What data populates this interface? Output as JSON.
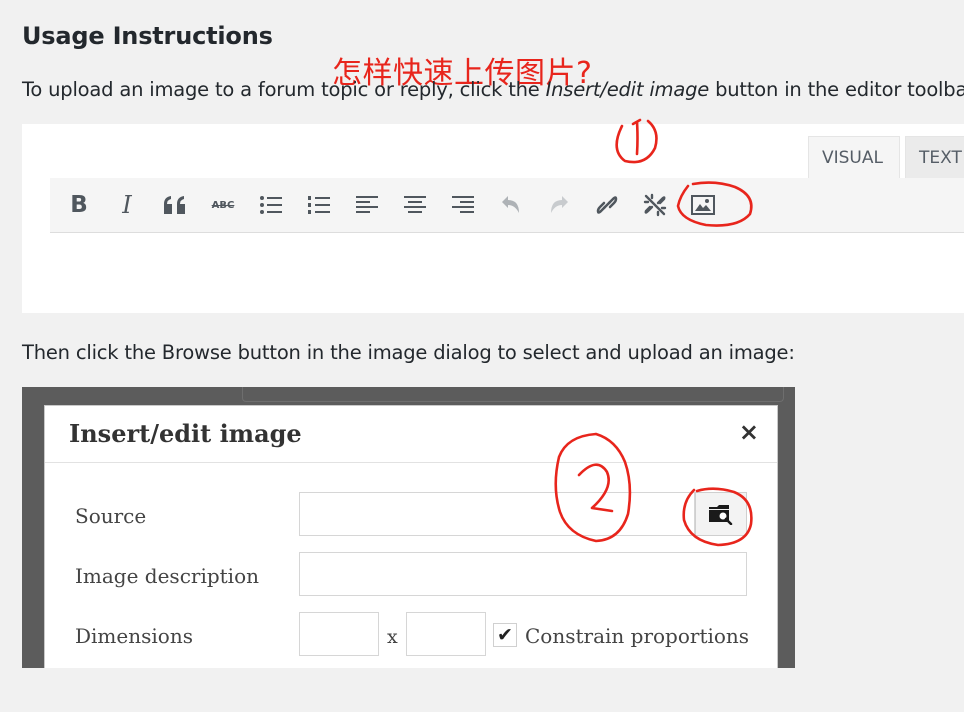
{
  "heading": "Usage Instructions",
  "annotation_cn": "怎样快速上传图片?",
  "instruction1": {
    "before": "To upload an image to a forum topic or reply, click the ",
    "emphasis": "Insert/edit image",
    "after": " button in the editor toolbar:"
  },
  "instruction2": "Then click the Browse button in the image dialog to select and upload an image:",
  "editor": {
    "tabs": {
      "visual": "VISUAL",
      "text": "TEXT"
    },
    "toolbar": {
      "bold": "B",
      "italic": "I",
      "quote": "“",
      "strike": "ABC",
      "icons": [
        "bold-icon",
        "italic-icon",
        "blockquote-icon",
        "strikethrough-icon",
        "bullet-list-icon",
        "numbered-list-icon",
        "align-left-icon",
        "align-center-icon",
        "align-right-icon",
        "undo-icon",
        "redo-icon",
        "link-icon",
        "unlink-icon",
        "image-icon"
      ]
    }
  },
  "dialog": {
    "title": "Insert/edit image",
    "close": "×",
    "source_label": "Source",
    "description_label": "Image description",
    "dimensions_label": "Dimensions",
    "dimension_separator": "x",
    "checkbox_mark": "✔",
    "constrain_label": "Constrain proportions",
    "browse_icon": "folder-search-icon"
  },
  "annotations": {
    "circle1": "①",
    "circle2": "②",
    "color": "#e8251c"
  }
}
